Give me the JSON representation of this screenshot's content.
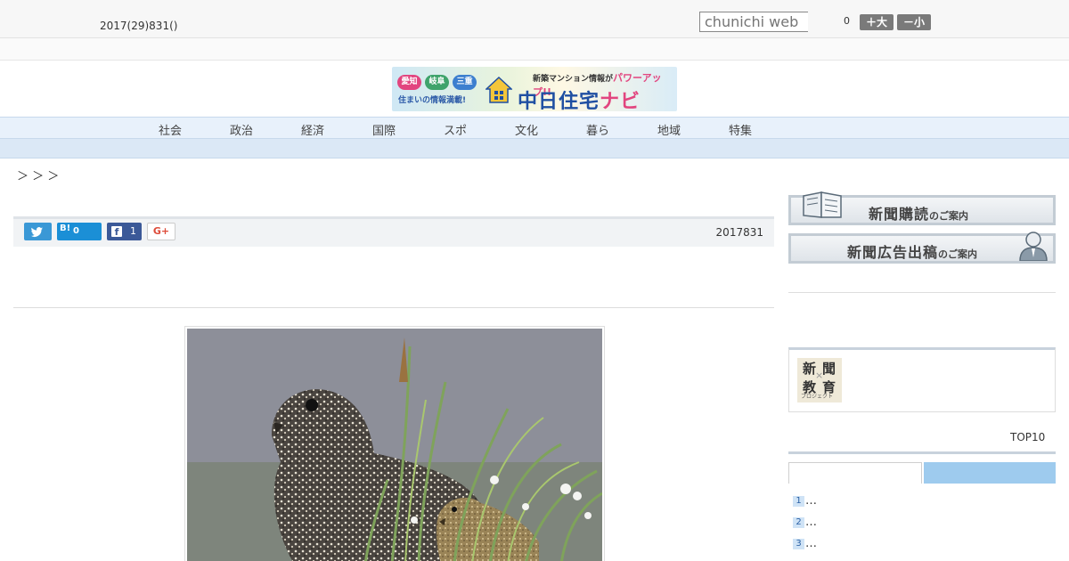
{
  "header": {
    "date": "2017(29)831()",
    "search_placeholder": "chunichi web",
    "font_count": "0",
    "font_bigger_label": "＋大",
    "font_smaller_label": "－小"
  },
  "banner": {
    "tags": [
      "愛知",
      "岐阜",
      "三重"
    ],
    "subtitle": "住まいの情報満載!",
    "top_text": "新築マンション情報が",
    "top_emphasis": "パワーアップ!!",
    "title_main": "中日住宅",
    "title_accent": "ナビ"
  },
  "nav": {
    "items": [
      "社会",
      "政治",
      "経済",
      "国際",
      "スポ",
      "文化",
      "暮ら",
      "地域",
      "特集"
    ]
  },
  "breadcrumb": {
    "text": "＞ ＞ ＞"
  },
  "share": {
    "hatena_label": "B!",
    "hatena_count": "0",
    "facebook_count": "1",
    "gplus_label": "G+"
  },
  "article": {
    "date": "2017831"
  },
  "sidebar": {
    "subscribe": {
      "main": "新聞購読",
      "suffix": "のご案内"
    },
    "advertise": {
      "main": "新聞広告出稿",
      "suffix": "のご案内"
    },
    "edu_logo": {
      "chars": [
        "新",
        "聞",
        "教",
        "育"
      ],
      "cross": "×",
      "caption": "プロジェクト"
    },
    "ranking_title": "TOP10",
    "ranking": [
      {
        "num": "1",
        "text": "…"
      },
      {
        "num": "2",
        "text": "…"
      },
      {
        "num": "3",
        "text": "…"
      }
    ]
  },
  "colors": {
    "nav_bg": "#e8f1fb",
    "twitter": "#3a98d6",
    "hatena": "#1b8fd6",
    "facebook": "#3b5998",
    "gplus": "#dd4b39",
    "ranking_tab_active": "#9ecbee"
  }
}
